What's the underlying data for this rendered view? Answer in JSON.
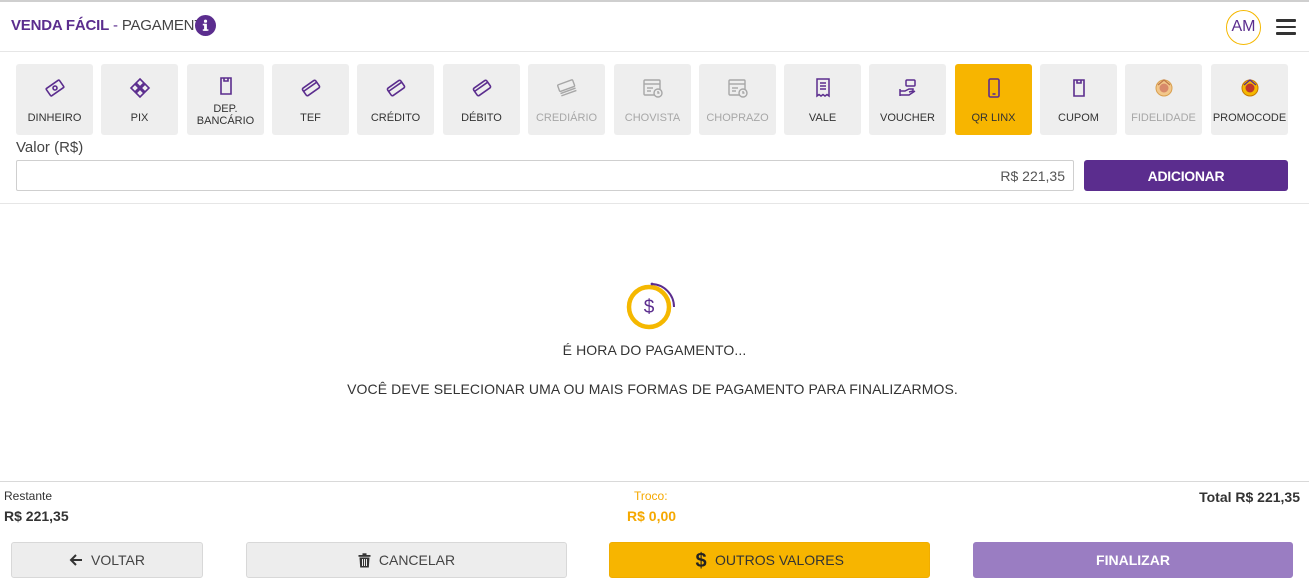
{
  "header": {
    "app_name": "VENDA FÁCIL",
    "separator": " - ",
    "page_title": "PAGAMENTO",
    "avatar_initials": "AM"
  },
  "payment_methods": [
    {
      "label": "DINHEIRO",
      "icon": "cash-icon",
      "state": "enabled"
    },
    {
      "label": "PIX",
      "icon": "pix-icon",
      "state": "enabled"
    },
    {
      "label": "DEP. BANCÁRIO",
      "icon": "receipt-icon",
      "state": "enabled"
    },
    {
      "label": "TEF",
      "icon": "card-icon",
      "state": "enabled"
    },
    {
      "label": "CRÉDITO",
      "icon": "card-icon",
      "state": "enabled"
    },
    {
      "label": "DÉBITO",
      "icon": "card-icon",
      "state": "enabled"
    },
    {
      "label": "CREDIÁRIO",
      "icon": "money-stack-icon",
      "state": "disabled"
    },
    {
      "label": "CHOVISTA",
      "icon": "check-clock-icon",
      "state": "disabled"
    },
    {
      "label": "CHOPRAZO",
      "icon": "check-clock-icon",
      "state": "disabled"
    },
    {
      "label": "VALE",
      "icon": "voucher-receipt-icon",
      "state": "enabled"
    },
    {
      "label": "VOUCHER",
      "icon": "hand-ticket-icon",
      "state": "enabled"
    },
    {
      "label": "QR LINX",
      "icon": "mobile-phone-icon",
      "state": "active"
    },
    {
      "label": "CUPOM",
      "icon": "coupon-icon",
      "state": "enabled"
    },
    {
      "label": "FIDELIDADE",
      "icon": "loyalty-icon",
      "state": "disabled"
    },
    {
      "label": "PROMOCODE",
      "icon": "promocode-icon",
      "state": "enabled"
    }
  ],
  "valor": {
    "label": "Valor (R$)",
    "value": "R$ 221,35",
    "add_label": "ADICIONAR"
  },
  "empty_state": {
    "icon": "dollar-coin-icon",
    "title": "É HORA DO PAGAMENTO...",
    "message": "VOCÊ DEVE SELECIONAR UMA OU MAIS FORMAS DE PAGAMENTO PARA FINALIZARMOS."
  },
  "summary": {
    "restante_label": "Restante",
    "restante_value": "R$ 221,35",
    "troco_label": "Troco:",
    "troco_value": "R$ 0,00",
    "total": "Total R$ 221,35"
  },
  "actions": {
    "voltar": "VOLTAR",
    "cancelar": "CANCELAR",
    "outros_valores": "OUTROS VALORES",
    "finalizar": "FINALIZAR"
  },
  "colors": {
    "brand_purple": "#5b2d8e",
    "accent_yellow": "#f7b500",
    "finalizar_disabled": "#9a7dc2"
  }
}
